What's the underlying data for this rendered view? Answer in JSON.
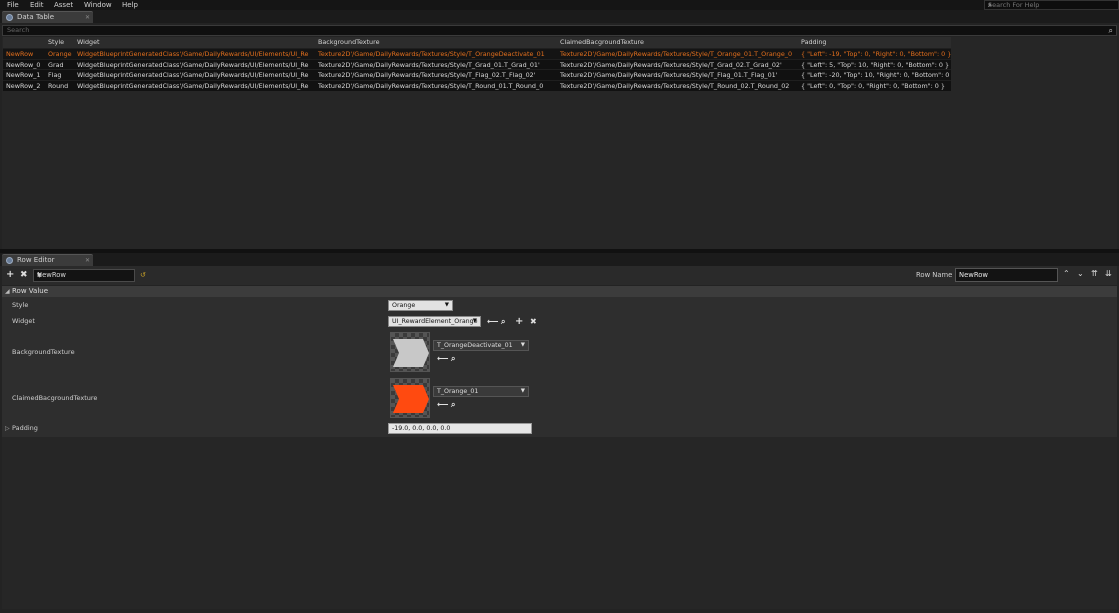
{
  "menu": [
    "File",
    "Edit",
    "Asset",
    "Window",
    "Help"
  ],
  "help_search": {
    "placeholder": "Search For Help"
  },
  "data_table_tab": {
    "label": "Data Table"
  },
  "search": {
    "placeholder": "Search"
  },
  "table": {
    "columns": [
      "",
      "Style",
      "Widget",
      "BackgroundTexture",
      "ClaimedBacgroundTexture",
      "Padding"
    ],
    "rows": [
      [
        "NewRow",
        "Orange",
        "WidgetBlueprintGeneratedClass'/Game/DailyRewards/UI/Elements/UI_Re",
        "Texture2D'/Game/DailyRewards/Textures/Style/T_OrangeDeactivate_01",
        "Texture2D'/Game/DailyRewards/Textures/Style/T_Orange_01.T_Orange_0",
        "{ \"Left\": -19, \"Top\": 0, \"Right\": 0, \"Bottom\": 0 }"
      ],
      [
        "NewRow_0",
        "Grad",
        "WidgetBlueprintGeneratedClass'/Game/DailyRewards/UI/Elements/UI_Re",
        "Texture2D'/Game/DailyRewards/Textures/Style/T_Grad_01.T_Grad_01'",
        "Texture2D'/Game/DailyRewards/Textures/Style/T_Grad_02.T_Grad_02'",
        "{ \"Left\": 5, \"Top\": 10, \"Right\": 0, \"Bottom\": 0 }"
      ],
      [
        "NewRow_1",
        "Flag",
        "WidgetBlueprintGeneratedClass'/Game/DailyRewards/UI/Elements/UI_Re",
        "Texture2D'/Game/DailyRewards/Textures/Style/T_Flag_02.T_Flag_02'",
        "Texture2D'/Game/DailyRewards/Textures/Style/T_Flag_01.T_Flag_01'",
        "{ \"Left\": -20, \"Top\": 10, \"Right\": 0, \"Bottom\": 0 }"
      ],
      [
        "NewRow_2",
        "Round",
        "WidgetBlueprintGeneratedClass'/Game/DailyRewards/UI/Elements/UI_Re",
        "Texture2D'/Game/DailyRewards/Textures/Style/T_Round_01.T_Round_0",
        "Texture2D'/Game/DailyRewards/Textures/Style/T_Round_02.T_Round_02",
        "{ \"Left\": 0, \"Top\": 0, \"Right\": 0, \"Bottom\": 0 }"
      ]
    ],
    "selected_row": 0
  },
  "row_editor_tab": {
    "label": "Row Editor"
  },
  "row_editor": {
    "current_row": "NewRow",
    "row_name_label": "Row Name",
    "row_name_value": "NewRow",
    "section_title": "Row Value",
    "props": {
      "style_label": "Style",
      "style_value": "Orange",
      "widget_label": "Widget",
      "widget_value": "UI_RewardElement_Orange",
      "bg_label": "BackgroundTexture",
      "bg_value": "T_OrangeDeactivate_01",
      "claimed_label": "ClaimedBacgroundTexture",
      "claimed_value": "T_Orange_01",
      "padding_label": "Padding",
      "padding_value": "-19.0, 0.0, 0.0, 0.0"
    }
  },
  "colors": {
    "selected_text": "#e36f1d",
    "orange_texture": "#ff4a10",
    "grey_texture": "#c8c8c8"
  }
}
